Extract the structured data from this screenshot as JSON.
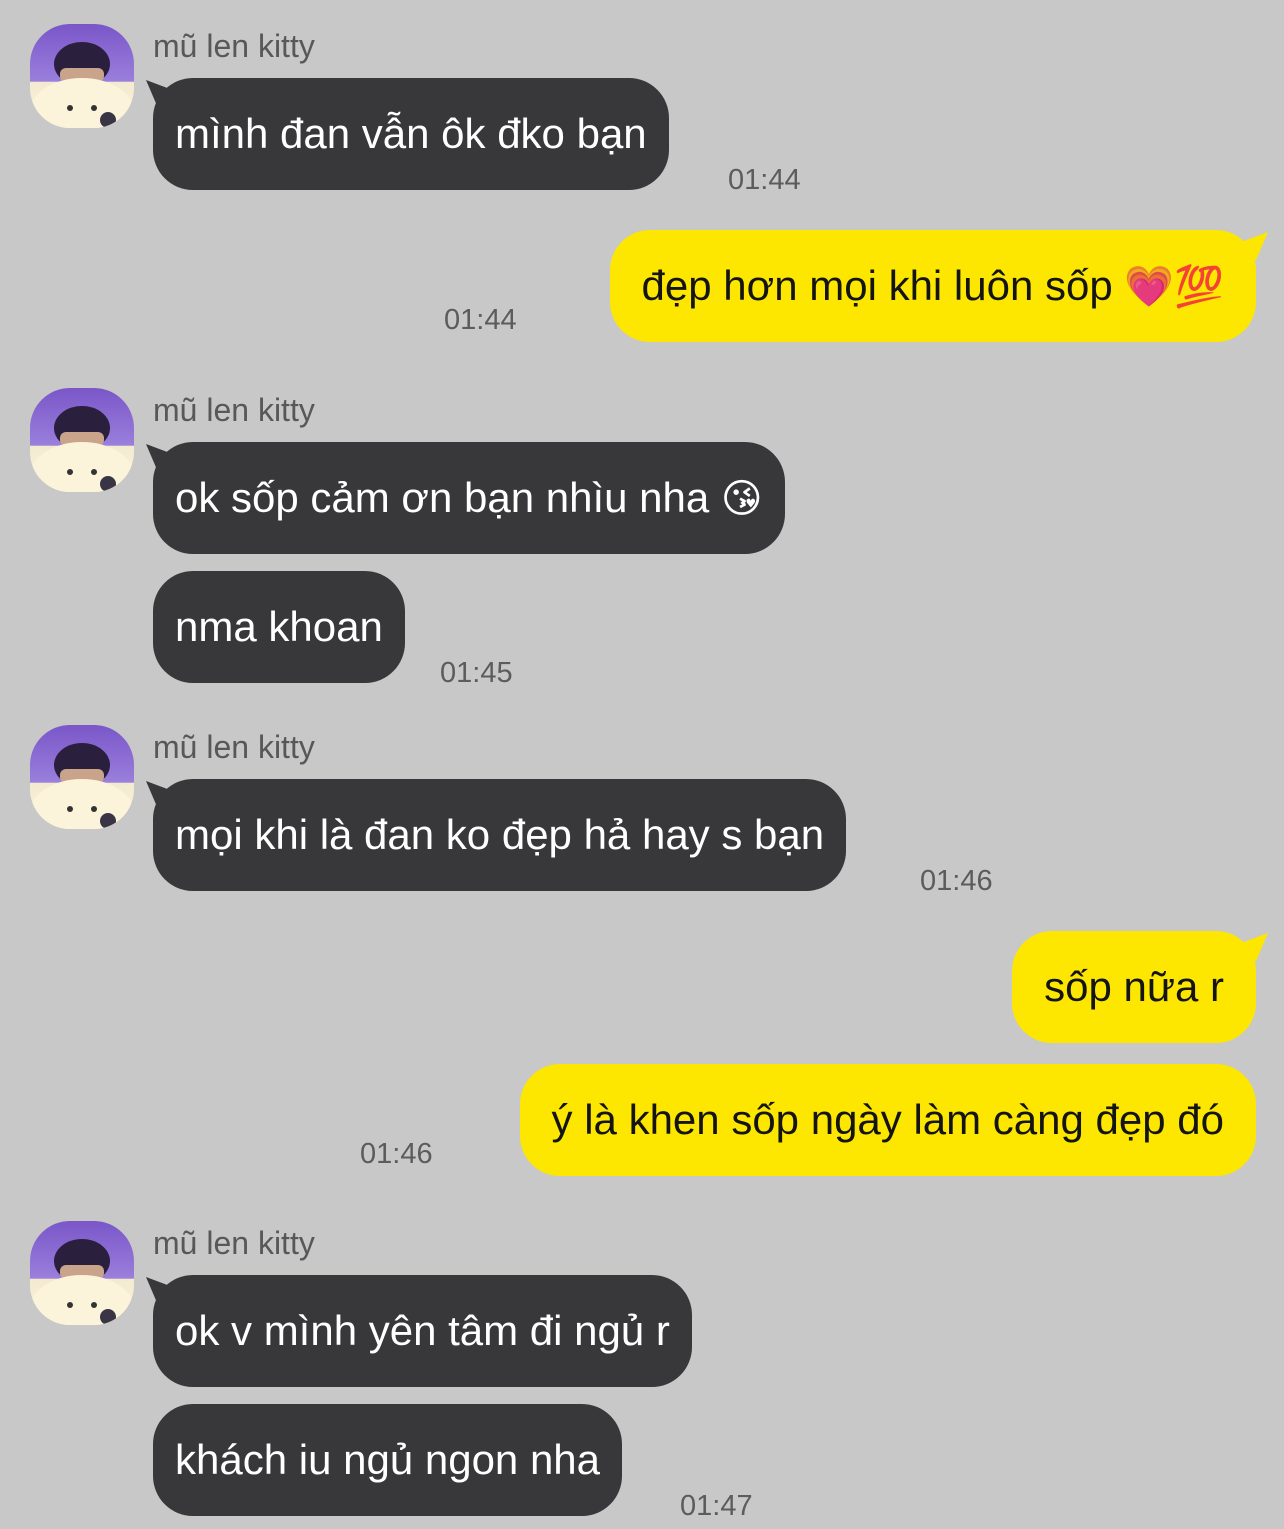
{
  "conversation": {
    "groups": [
      {
        "sender": "mũ len kitty",
        "avatar": "user-avatar",
        "messages": [
          {
            "text": "mình đan vẫn ôk đko bạn",
            "time": "01:44"
          }
        ]
      },
      {
        "direction": "outgoing",
        "messages": [
          {
            "text": "đẹp hơn mọi khi luôn sốp",
            "emoji": "💗💯",
            "time": "01:44"
          }
        ]
      },
      {
        "sender": "mũ len kitty",
        "avatar": "user-avatar",
        "messages": [
          {
            "text": "ok sốp cảm ơn bạn nhìu nha",
            "emoji": "😘"
          },
          {
            "text": "nma khoan",
            "time": "01:45"
          }
        ]
      },
      {
        "sender": "mũ len kitty",
        "avatar": "user-avatar",
        "messages": [
          {
            "text": "mọi khi là đan ko đẹp hả hay s bạn",
            "time": "01:46"
          }
        ]
      },
      {
        "direction": "outgoing",
        "messages": [
          {
            "text": "sốp nữa r"
          },
          {
            "text": "ý là khen sốp ngày làm càng đẹp đó",
            "time": "01:46"
          }
        ]
      },
      {
        "sender": "mũ len kitty",
        "avatar": "user-avatar",
        "messages": [
          {
            "text": "ok v mình yên tâm đi ngủ r"
          },
          {
            "text": "khách iu ngủ ngon nha",
            "time": "01:47"
          }
        ]
      }
    ]
  },
  "colors": {
    "background": "#c8c8c8",
    "incoming_bubble": "#38383a",
    "outgoing_bubble": "#fde700"
  }
}
